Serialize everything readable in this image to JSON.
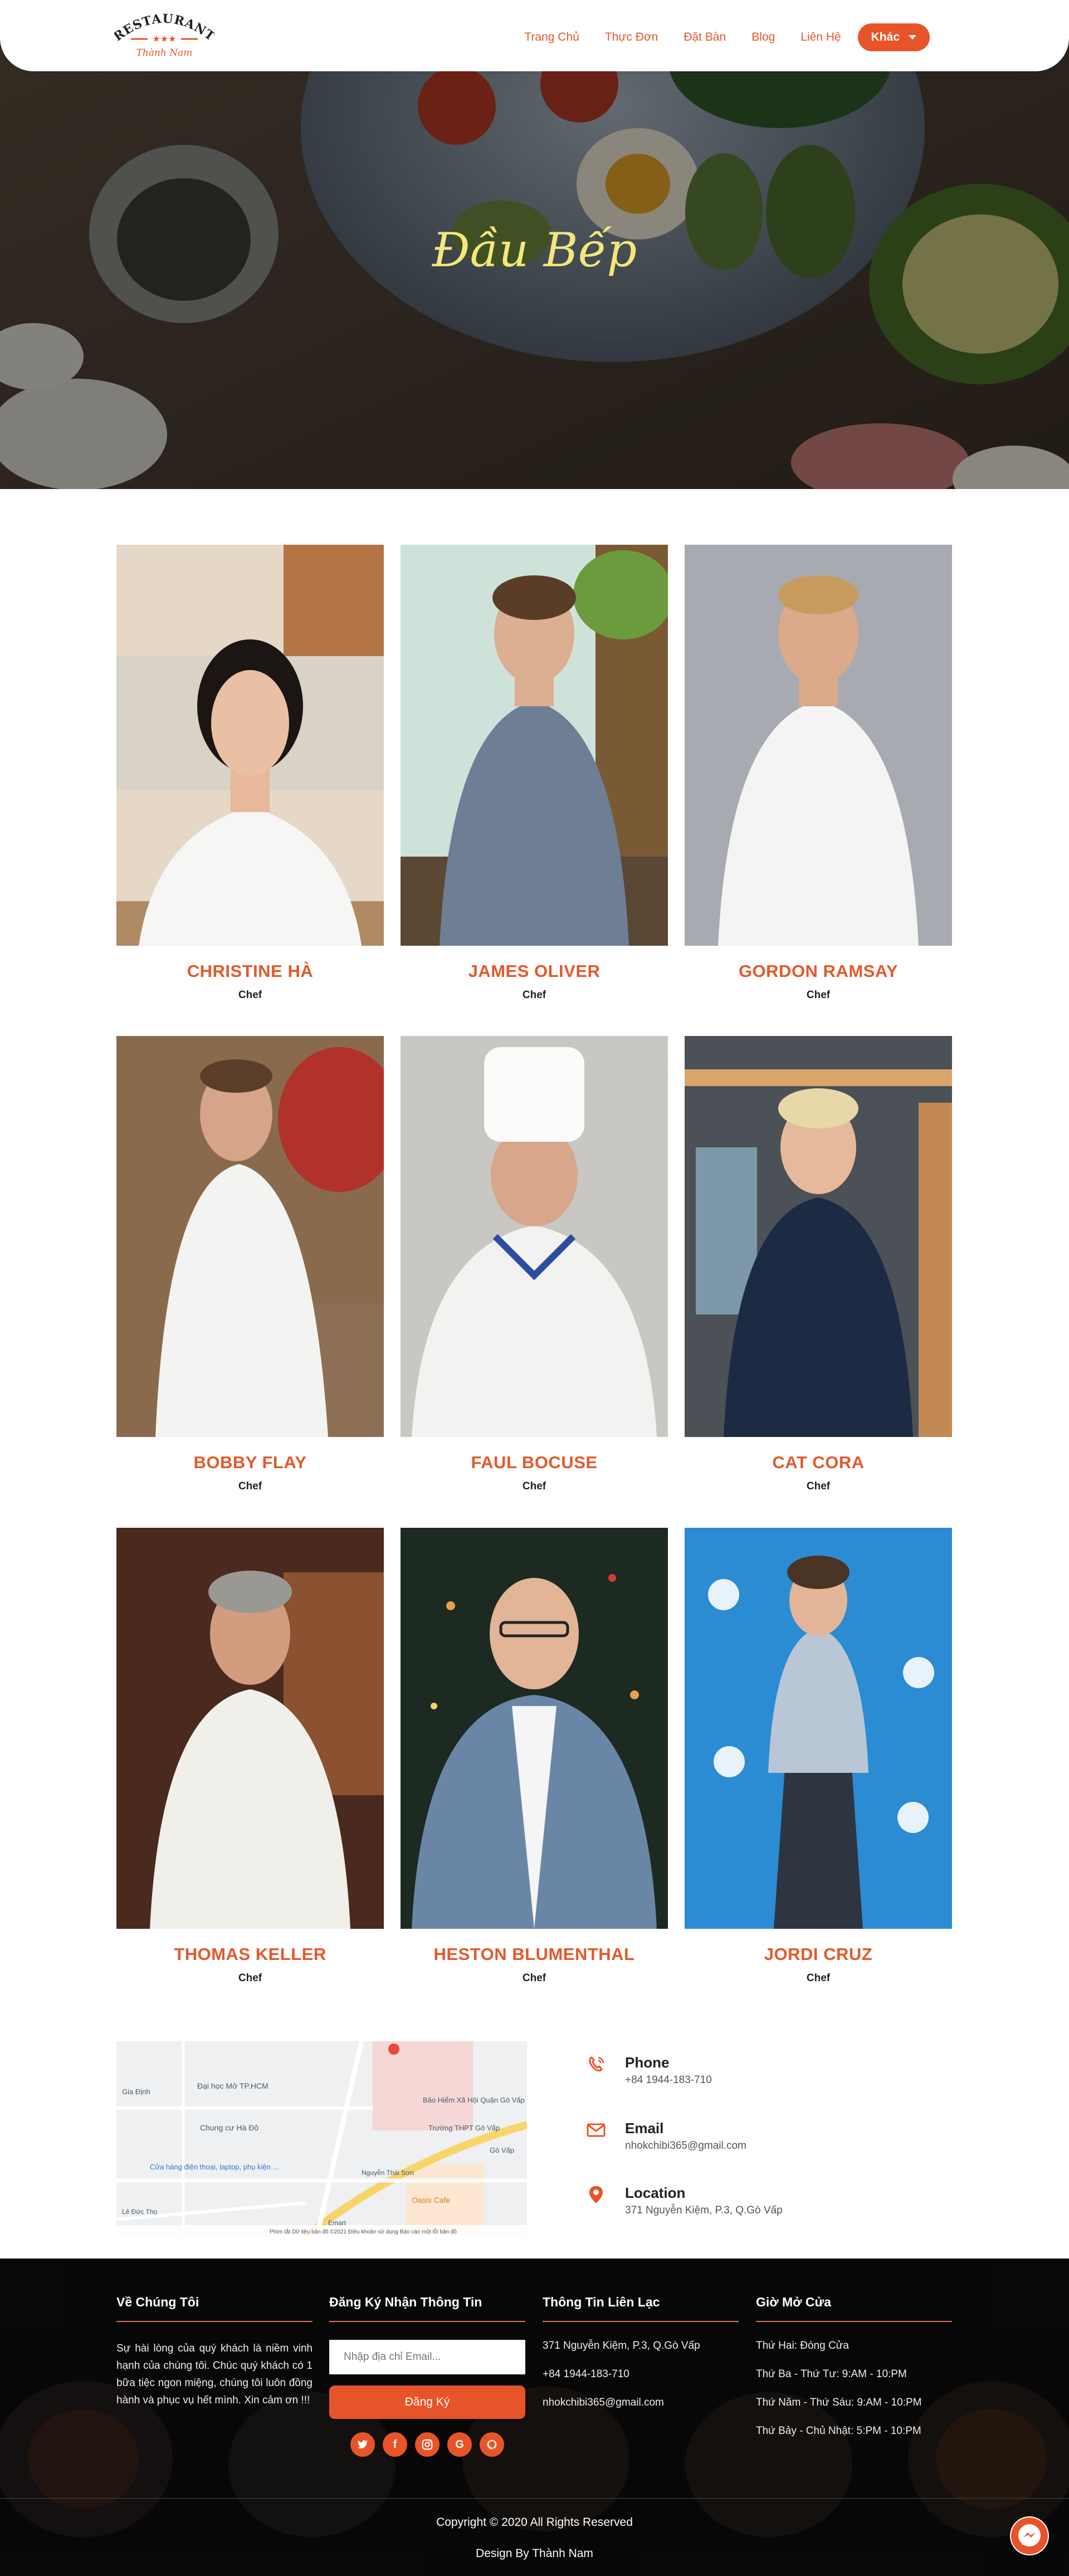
{
  "nav": {
    "logo_top": "RESTAURANT",
    "logo_bottom": "Thành Nam",
    "items": [
      "Trang Chủ",
      "Thực Đơn",
      "Đặt Bàn",
      "Blog",
      "Liên Hệ"
    ],
    "dropdown_label": "Khác"
  },
  "hero": {
    "title": "Đầu Bếp"
  },
  "chefs": [
    {
      "name": "CHRISTINE HÀ",
      "role": "Chef"
    },
    {
      "name": "JAMES OLIVER",
      "role": "Chef"
    },
    {
      "name": "GORDON RAMSAY",
      "role": "Chef"
    },
    {
      "name": "BOBBY FLAY",
      "role": "Chef"
    },
    {
      "name": "FAUL BOCUSE",
      "role": "Chef"
    },
    {
      "name": "CAT CORA",
      "role": "Chef"
    },
    {
      "name": "THOMAS KELLER",
      "role": "Chef"
    },
    {
      "name": "HESTON BLUMENTHAL",
      "role": "Chef"
    },
    {
      "name": "JORDI CRUZ",
      "role": "Chef"
    }
  ],
  "map": {
    "labels": [
      "Đại học Mở TP.HCM",
      "Chung cư Hà Đô",
      "Bảo Hiểm Xã Hội Quận Gò Vấp",
      "Trường THPT Gò Vấp",
      "Gia Định",
      "Cửa hàng điện thoại, laptop, phụ kiện ...",
      "Oasis Cafe",
      "Lê Đức Thọ",
      "Gò Vấp",
      "Emart",
      "Nguyễn Thái Sơn"
    ],
    "attribution": "Phím tắt   Dữ liệu bản đồ ©2021   Điều khoản sử dụng   Báo cáo một lỗi bản đồ"
  },
  "contact": {
    "phone_title": "Phone",
    "phone": "+84 1944-183-710",
    "email_title": "Email",
    "email": "nhokchibi365@gmail.com",
    "location_title": "Location",
    "location": "371 Nguyễn Kiệm, P.3, Q.Gò Vấp"
  },
  "footer": {
    "about_title": "Về Chúng Tôi",
    "about_text": "Sự hài lòng của quý khách là niềm vinh hạnh của chúng tôi. Chúc quý khách có 1 bữa tiệc ngon miệng, chúng tôi luôn đồng hành và phục vụ hết mình. Xin cảm ơn !!!",
    "newsletter_title": "Đăng Ký Nhận Thông Tin",
    "email_placeholder": "Nhập địa chỉ Email...",
    "subscribe_label": "Đăng Ký",
    "social_icons": [
      "twitter-icon",
      "facebook-icon",
      "instagram-icon",
      "google-icon",
      "github-icon"
    ],
    "contact_title": "Thông Tin Liên Lạc",
    "contact_lines": [
      "371 Nguyễn Kiệm, P.3, Q.Gò Vấp",
      "+84 1944-183-710",
      "nhokchibi365@gmail.com"
    ],
    "hours_title": "Giờ Mở Cửa",
    "hours_lines": [
      "Thứ Hai: Đóng Cửa",
      "Thứ Ba - Thứ Tư: 9:AM - 10:PM",
      "Thứ Năm - Thứ Sáu: 9:AM - 10:PM",
      "Thứ Bảy - Chủ Nhật: 5:PM - 10:PM"
    ],
    "copyright": "Copyright © 2020 All Rights Reserved",
    "design": "Design By Thành Nam"
  },
  "colors": {
    "accent": "#e8542a",
    "title_yellow": "#f4e77b"
  }
}
